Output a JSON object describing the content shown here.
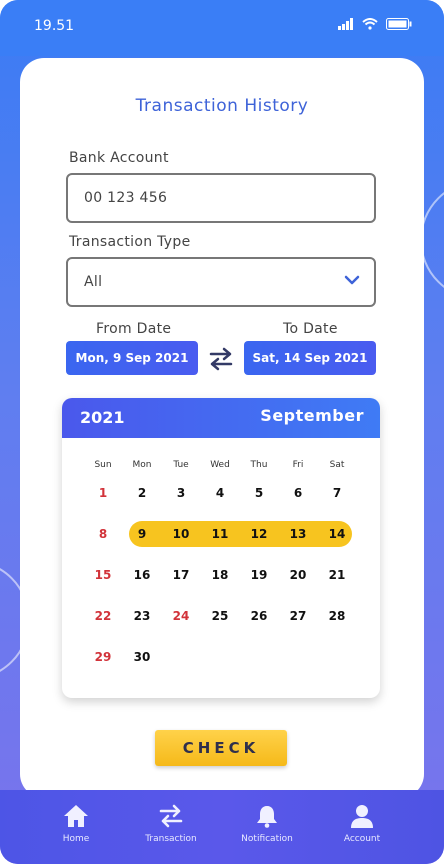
{
  "status_bar": {
    "time": "19.51"
  },
  "header": {
    "title": "Transaction History"
  },
  "form": {
    "bank_account_label": "Bank Account",
    "bank_account_value": "00 123 456",
    "transaction_type_label": "Transaction Type",
    "transaction_type_value": "All",
    "from_date_label": "From Date",
    "to_date_label": "To Date",
    "from_date_value": "Mon, 9 Sep 2021",
    "to_date_value": "Sat, 14 Sep 2021"
  },
  "calendar": {
    "year": "2021",
    "month": "September",
    "weekdays": [
      "Sun",
      "Mon",
      "Tue",
      "Wed",
      "Thu",
      "Fri",
      "Sat"
    ],
    "weeks": [
      [
        "1",
        "2",
        "3",
        "4",
        "5",
        "6",
        "7"
      ],
      [
        "8",
        "9",
        "10",
        "11",
        "12",
        "13",
        "14"
      ],
      [
        "15",
        "16",
        "17",
        "18",
        "19",
        "20",
        "21"
      ],
      [
        "22",
        "23",
        "24",
        "25",
        "26",
        "27",
        "28"
      ],
      [
        "29",
        "30",
        "",
        "",
        "",
        "",
        ""
      ]
    ],
    "red_days": [
      "1",
      "8",
      "15",
      "22",
      "24",
      "29"
    ],
    "selected_range": [
      "9",
      "10",
      "11",
      "12",
      "13",
      "14"
    ],
    "highlight_color": "#f7c41f",
    "holiday_color": "#d2333a"
  },
  "actions": {
    "check_label": "CHECK"
  },
  "nav": {
    "items": [
      {
        "label": "Home",
        "icon": "home-icon"
      },
      {
        "label": "Transaction",
        "icon": "transfer-arrows-icon"
      },
      {
        "label": "Notification",
        "icon": "bell-icon"
      },
      {
        "label": "Account",
        "icon": "user-icon"
      }
    ]
  },
  "colors": {
    "accent": "#3e63d8",
    "button_yellow": "#f5b919",
    "nav_bg": "#5058e8"
  }
}
